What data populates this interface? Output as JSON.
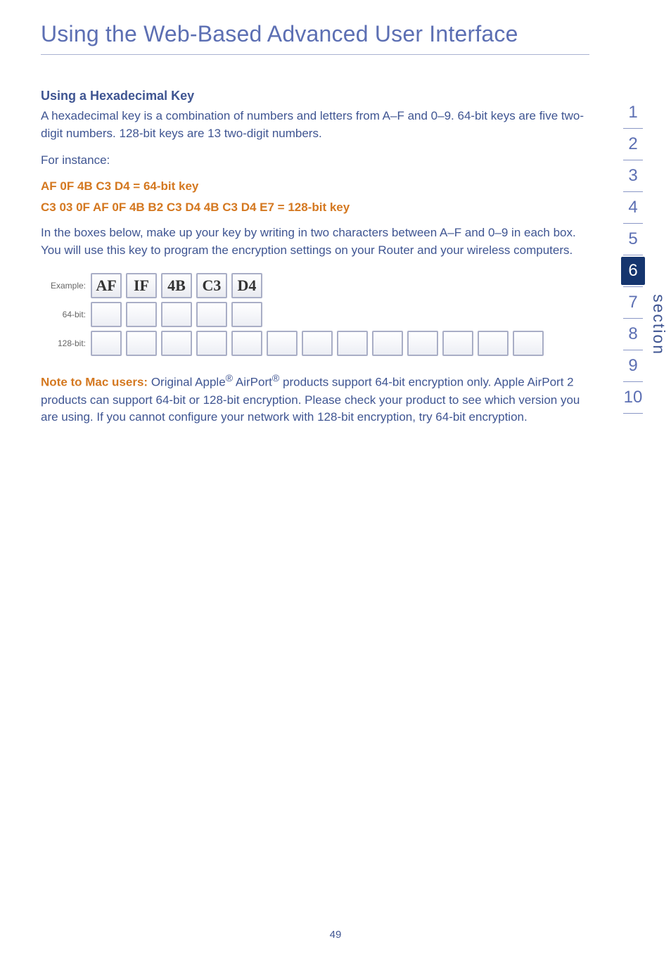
{
  "page_title": "Using the Web-Based Advanced User Interface",
  "hex_key": {
    "heading": "Using a Hexadecimal Key",
    "para1": "A hexadecimal key is a combination of numbers and letters from A–F and 0–9. 64-bit keys are five two-digit numbers. 128-bit keys are 13 two-digit numbers.",
    "for_instance": "For instance:",
    "line64": "AF 0F 4B C3 D4 = 64-bit key",
    "line128": "C3 03 0F AF 0F 4B B2 C3 D4 4B C3 D4 E7 = 128-bit key",
    "para2": "In the boxes below, make up your key by writing in two characters between A–F and 0–9 in each box. You will use this key to program the encryption settings on your Router and your wireless computers."
  },
  "key_grid": {
    "labels": {
      "example": "Example:",
      "bit64": "64-bit:",
      "bit128": "128-bit:"
    },
    "example_values": [
      "AF",
      "IF",
      "4B",
      "C3",
      "D4"
    ],
    "row64_count": 5,
    "row128_count": 13
  },
  "note": {
    "lead": "Note to Mac users: ",
    "text_a": "Original Apple",
    "reg1": "®",
    "text_b": " AirPort",
    "reg2": "®",
    "text_c": " products support 64-bit encryption only. Apple AirPort 2 products can support 64-bit or 128-bit encryption. Please check your product to see which version you are using. If you cannot configure your network with 128-bit encryption, try 64-bit encryption."
  },
  "section_nav": {
    "items": [
      "1",
      "2",
      "3",
      "4",
      "5",
      "6",
      "7",
      "8",
      "9",
      "10"
    ],
    "active_index": 5,
    "word": "section"
  },
  "page_number": "49"
}
